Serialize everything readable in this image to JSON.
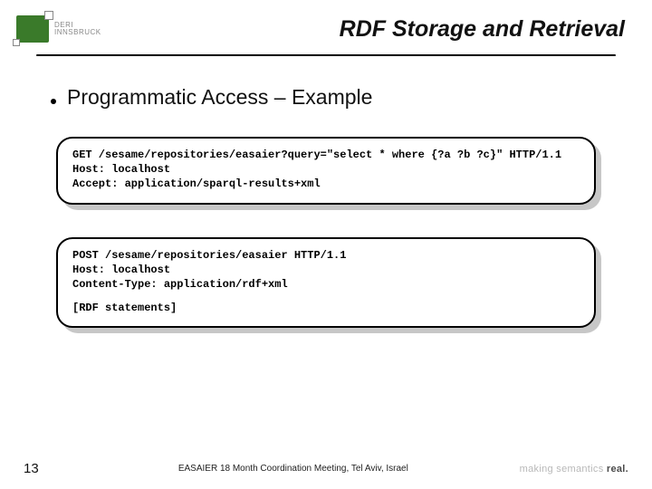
{
  "header": {
    "logo_text_top": "DERI",
    "logo_text_sub": "INNSBRUCK",
    "title": "RDF Storage and Retrieval"
  },
  "bullet": {
    "text": "Programmatic Access – Example"
  },
  "code_box_1": {
    "line1": "GET /sesame/repositories/easaier?query=\"select * where {?a ?b ?c}\" HTTP/1.1",
    "line2": "Host: localhost",
    "line3": "Accept: application/sparql-results+xml"
  },
  "code_box_2": {
    "line1": "POST /sesame/repositories/easaier HTTP/1.1",
    "line2": "Host: localhost",
    "line3": "Content-Type: application/rdf+xml",
    "line4": "[RDF statements]"
  },
  "footer": {
    "page_number": "13",
    "center_text": "EASAIER 18 Month Coordination Meeting, Tel Aviv, Israel",
    "tagline_prefix": "making semantics ",
    "tagline_emph": "real."
  }
}
